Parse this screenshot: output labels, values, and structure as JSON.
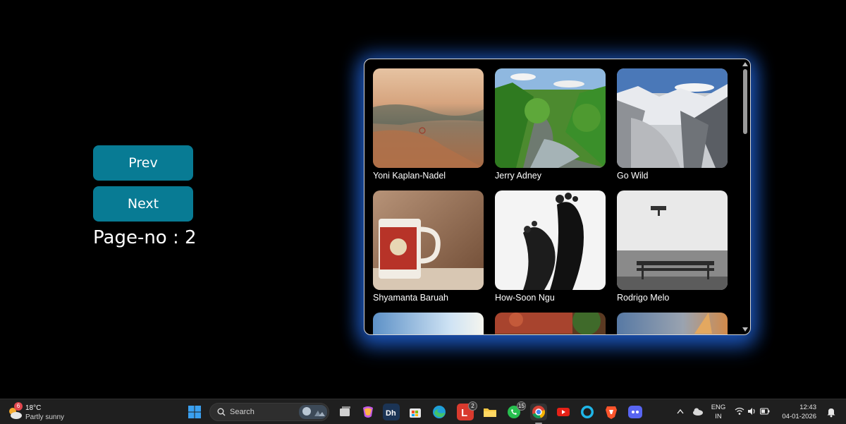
{
  "controls": {
    "prev_label": "Prev",
    "next_label": "Next",
    "page_indicator": "Page-no : 2"
  },
  "gallery": {
    "items": [
      {
        "author": "Yoni Kaplan-Nadel",
        "image": "desert-sunset-landscape"
      },
      {
        "author": "Jerry Adney",
        "image": "forest-river-canyon"
      },
      {
        "author": "Go Wild",
        "image": "snowy-mountains"
      },
      {
        "author": "Shyamanta Baruah",
        "image": "vintage-mug"
      },
      {
        "author": "How-Soon Ngu",
        "image": "bw-feet"
      },
      {
        "author": "Rodrigo Melo",
        "image": "bench-against-wall"
      },
      {
        "author": "",
        "image": "sky-partial"
      },
      {
        "author": "",
        "image": "red-foliage-partial"
      },
      {
        "author": "",
        "image": "blurred-warm-partial"
      }
    ]
  },
  "taskbar": {
    "weather": {
      "temp": "18°C",
      "desc": "Partly sunny",
      "badge": "6"
    },
    "search_placeholder": "Search",
    "apps": [
      {
        "icon": "windows-start-icon"
      },
      {
        "icon": "task-view-icon"
      },
      {
        "icon": "copilot-icon"
      },
      {
        "icon": "dh-app-icon"
      },
      {
        "icon": "microsoft-store-icon"
      },
      {
        "icon": "edge-icon"
      },
      {
        "icon": "l-app-icon",
        "badge": "2"
      },
      {
        "icon": "file-explorer-icon"
      },
      {
        "icon": "whatsapp-icon",
        "badge": "15"
      },
      {
        "icon": "chrome-icon",
        "active": true
      },
      {
        "icon": "youtube-icon"
      },
      {
        "icon": "alexa-icon"
      },
      {
        "icon": "brave-icon"
      },
      {
        "icon": "discord-icon"
      }
    ],
    "tray": {
      "lang_top": "ENG",
      "lang_bottom": "IN",
      "time": "12:43",
      "date": "04-01-2026"
    }
  },
  "colors": {
    "button_bg": "#087b94",
    "glow": "#2369e6",
    "background": "#000000"
  }
}
